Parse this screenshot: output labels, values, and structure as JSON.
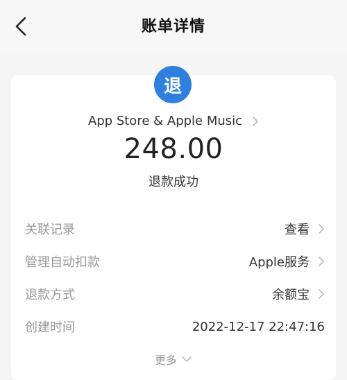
{
  "header": {
    "title": "账单详情",
    "back_icon": "chevron-left-icon"
  },
  "summary": {
    "badge_text": "退",
    "badge_color": "#2f7fe1",
    "merchant": "App Store & Apple Music",
    "amount": "248.00",
    "status": "退款成功"
  },
  "details": [
    {
      "label": "关联记录",
      "value": "查看",
      "has_chevron": true
    },
    {
      "label": "管理自动扣款",
      "value": "Apple服务",
      "has_chevron": true
    },
    {
      "label": "退款方式",
      "value": "余额宝",
      "has_chevron": true
    },
    {
      "label": "创建时间",
      "value": "2022-12-17 22:47:16",
      "has_chevron": false
    }
  ],
  "more": {
    "label": "更多",
    "icon": "chevron-down-icon"
  },
  "colors": {
    "accent": "#2f7fe1",
    "label": "#999999",
    "value": "#333333",
    "background": "#f5f5f5",
    "card": "#ffffff"
  }
}
